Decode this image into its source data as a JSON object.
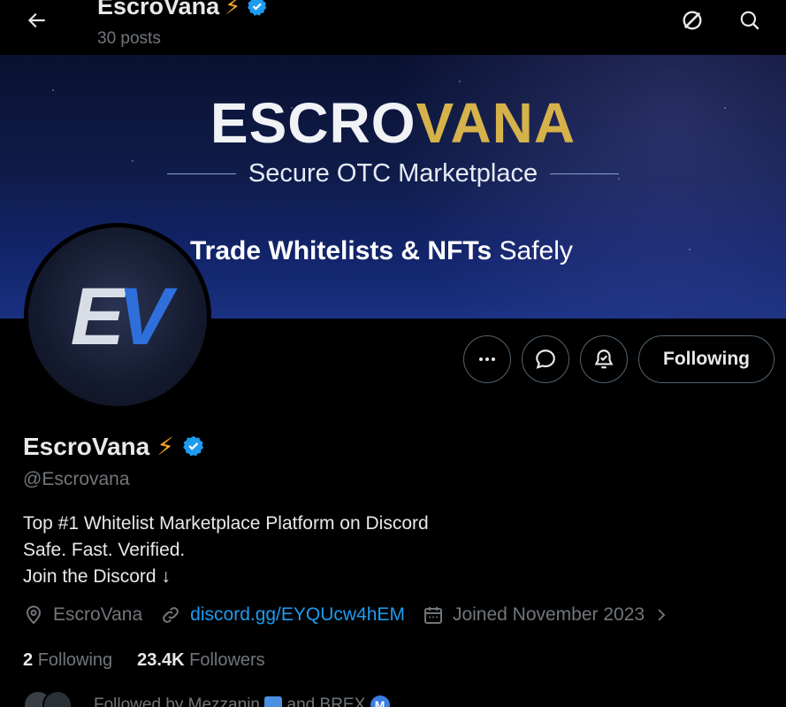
{
  "header": {
    "name": "EscroVana",
    "name_emoji": "⚡",
    "posts": "30 posts"
  },
  "banner": {
    "logo_white": "ESCRO",
    "logo_gold": "VANA",
    "subtitle": "Secure OTC Marketplace",
    "tagline_bold": "Trade Whitelists & NFTs",
    "tagline_rest": "Safely"
  },
  "avatar": {
    "letter_e": "E",
    "letter_v": "V"
  },
  "actions": {
    "follow_label": "Following"
  },
  "profile": {
    "name": "EscroVana",
    "name_emoji": "⚡",
    "handle": "@Escrovana",
    "bio": [
      "Top #1 Whitelist Marketplace Platform on Discord",
      "Safe. Fast. Verified.",
      "Join the Discord ↓"
    ],
    "location": "EscroVana",
    "link": "discord.gg/EYQUcw4hEM",
    "joined": "Joined November 2023",
    "following_count": "2",
    "following_label": "Following",
    "followers_count": "23.4K",
    "followers_label": "Followers",
    "followed_by_prefix": "Followed by Mezzanin",
    "followed_by_mid": "and BREX"
  },
  "colors": {
    "accent": "#1d9bf0",
    "gold": "#d6b24a",
    "muted": "#71767b",
    "verified": "#1d9bf0"
  }
}
